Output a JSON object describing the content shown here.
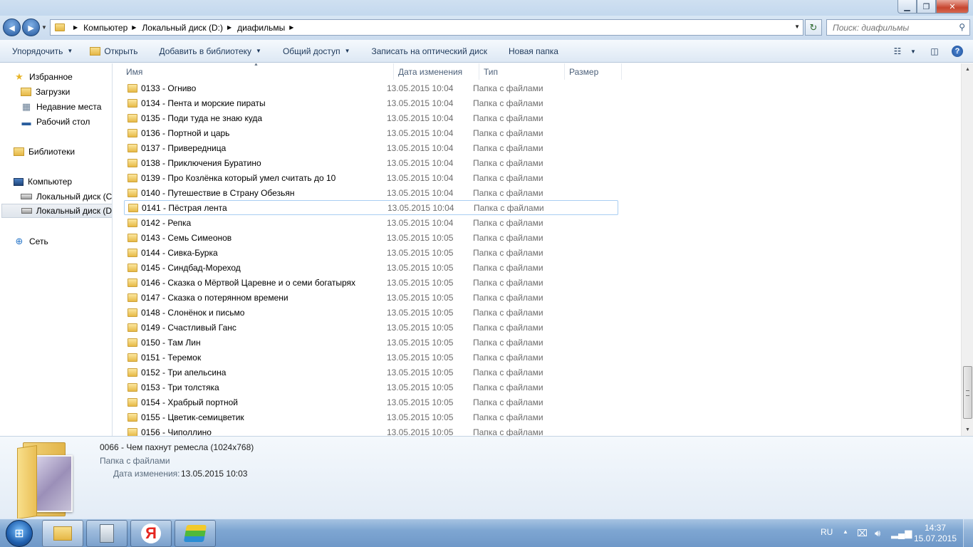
{
  "window": {
    "min_glyph": "▁",
    "max_glyph": "❐",
    "close_glyph": "✕"
  },
  "address": {
    "crumbs": [
      "Компьютер",
      "Локальный диск (D:)",
      "диафильмы"
    ],
    "search_placeholder": "Поиск: диафильмы"
  },
  "toolbar": {
    "organize": "Упорядочить",
    "open": "Открыть",
    "add_to_library": "Добавить в библиотеку",
    "share": "Общий доступ",
    "burn": "Записать на оптический диск",
    "new_folder": "Новая папка"
  },
  "nav": {
    "favorites": "Избранное",
    "downloads": "Загрузки",
    "recent": "Недавние места",
    "desktop": "Рабочий стол",
    "libraries": "Библиотеки",
    "computer": "Компьютер",
    "disk_c": "Локальный диск (C",
    "disk_d": "Локальный диск (D",
    "network": "Сеть"
  },
  "columns": {
    "name": "Имя",
    "date": "Дата изменения",
    "type": "Тип",
    "size": "Размер"
  },
  "files": [
    {
      "name": "0133 - Огниво",
      "date": "13.05.2015 10:04",
      "type": "Папка с файлами"
    },
    {
      "name": "0134 - Пента и морские пираты",
      "date": "13.05.2015 10:04",
      "type": "Папка с файлами"
    },
    {
      "name": "0135 - Поди туда не знаю куда",
      "date": "13.05.2015 10:04",
      "type": "Папка с файлами"
    },
    {
      "name": "0136 - Портной и царь",
      "date": "13.05.2015 10:04",
      "type": "Папка с файлами"
    },
    {
      "name": "0137 - Привередница",
      "date": "13.05.2015 10:04",
      "type": "Папка с файлами"
    },
    {
      "name": "0138 - Приключения Буратино",
      "date": "13.05.2015 10:04",
      "type": "Папка с файлами"
    },
    {
      "name": "0139 - Про Козлёнка который умел считать до 10",
      "date": "13.05.2015 10:04",
      "type": "Папка с файлами"
    },
    {
      "name": "0140 - Путешествие в Страну Обезьян",
      "date": "13.05.2015 10:04",
      "type": "Папка с файлами"
    },
    {
      "name": "0141 - Пёстрая лента",
      "date": "13.05.2015 10:04",
      "type": "Папка с файлами"
    },
    {
      "name": "0142 - Репка",
      "date": "13.05.2015 10:04",
      "type": "Папка с файлами"
    },
    {
      "name": "0143 - Семь Симеонов",
      "date": "13.05.2015 10:05",
      "type": "Папка с файлами"
    },
    {
      "name": "0144 - Сивка-Бурка",
      "date": "13.05.2015 10:05",
      "type": "Папка с файлами"
    },
    {
      "name": "0145 - Синдбад-Мореход",
      "date": "13.05.2015 10:05",
      "type": "Папка с файлами"
    },
    {
      "name": "0146 - Сказка о Мёртвой Царевне и о семи богатырях",
      "date": "13.05.2015 10:05",
      "type": "Папка с файлами"
    },
    {
      "name": "0147 - Сказка о потерянном времени",
      "date": "13.05.2015 10:05",
      "type": "Папка с файлами"
    },
    {
      "name": "0148 - Слонёнок и письмо",
      "date": "13.05.2015 10:05",
      "type": "Папка с файлами"
    },
    {
      "name": "0149 - Счастливый Ганс",
      "date": "13.05.2015 10:05",
      "type": "Папка с файлами"
    },
    {
      "name": "0150 - Там Лин",
      "date": "13.05.2015 10:05",
      "type": "Папка с файлами"
    },
    {
      "name": "0151 - Теремок",
      "date": "13.05.2015 10:05",
      "type": "Папка с файлами"
    },
    {
      "name": "0152 - Три апельсина",
      "date": "13.05.2015 10:05",
      "type": "Папка с файлами"
    },
    {
      "name": "0153 - Три толстяка",
      "date": "13.05.2015 10:05",
      "type": "Папка с файлами"
    },
    {
      "name": "0154 - Храбрый портной",
      "date": "13.05.2015 10:05",
      "type": "Папка с файлами"
    },
    {
      "name": "0155 - Цветик-семицветик",
      "date": "13.05.2015 10:05",
      "type": "Папка с файлами"
    },
    {
      "name": "0156 - Чиполлино",
      "date": "13.05.2015 10:05",
      "type": "Папка с файлами"
    }
  ],
  "hovered_index": 8,
  "details": {
    "title": "0066 - Чем пахнут ремесла (1024x768)",
    "type": "Папка с файлами",
    "date_label": "Дата изменения:",
    "date_value": "13.05.2015 10:03"
  },
  "taskbar": {
    "lang": "RU",
    "time": "14:37",
    "date": "15.07.2015",
    "yandex_letter": "Я"
  }
}
